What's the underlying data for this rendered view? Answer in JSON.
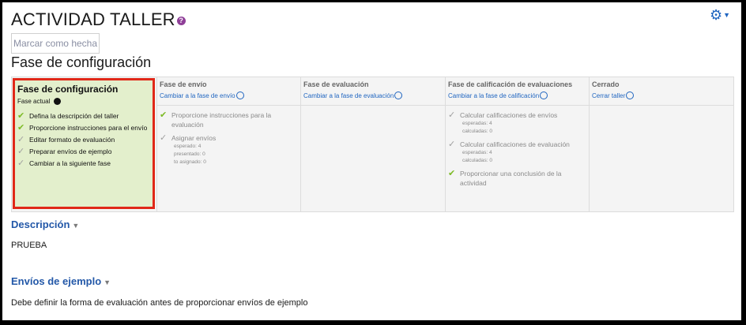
{
  "header": {
    "title": "ACTIVIDAD TALLER",
    "mark_done": "Marcar como hecha",
    "phase_heading": "Fase de configuración"
  },
  "phases": [
    {
      "name": "Fase de configuración",
      "current_label": "Fase actual",
      "tasks": [
        "Defina la descripción del taller",
        "Proporcione instrucciones para el envío",
        "Editar formato de evaluación",
        "Preparar envíos de ejemplo",
        "Cambiar a la siguiente fase"
      ]
    },
    {
      "name": "Fase de envío",
      "link": "Cambiar a la fase de envío",
      "tasks": [
        "Proporcione instrucciones para la evaluación",
        "Asignar envíos"
      ],
      "details": [
        "esperado: 4",
        "presentado: 0",
        "to asignado: 0"
      ]
    },
    {
      "name": "Fase de evaluación",
      "link": "Cambiar a la fase de evaluación"
    },
    {
      "name": "Fase de calificación de evaluaciones",
      "link": "Cambiar a la fase de calificación",
      "tasks": [
        "Calcular calificaciones de envíos",
        "Calcular calificaciones de evaluación",
        "Proporcionar una conclusión de la actividad"
      ],
      "details": [
        "esperadas: 4",
        "calculadas: 0",
        "esperadas: 4",
        "calculadas: 0"
      ]
    },
    {
      "name": "Cerrado",
      "link": "Cerrar taller"
    }
  ],
  "sections": [
    {
      "title": "Descripción",
      "text": "PRUEBA"
    },
    {
      "title": "Envíos de ejemplo",
      "text": "Debe definir la forma de evaluación antes de proporcionar envíos de ejemplo"
    }
  ],
  "colors": {
    "accent": "#2358a8",
    "link": "#1f65c0",
    "active_phase_bg": "#e3efcc",
    "highlight_border": "#e02818",
    "check_green": "#7cba25"
  }
}
